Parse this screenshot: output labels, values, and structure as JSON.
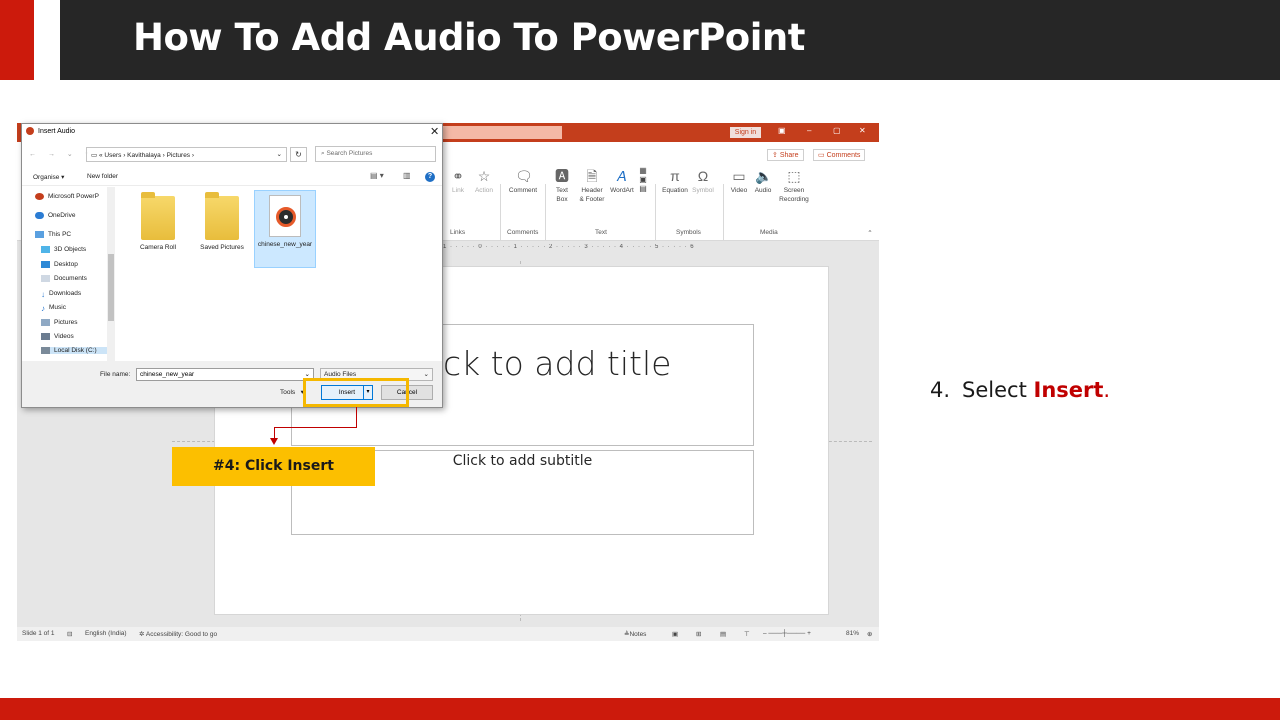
{
  "slide": {
    "title": "How To Add Audio To PowerPoint",
    "step_number": "4.",
    "step_prefix": "Select ",
    "step_keyword": "Insert",
    "step_suffix": ".",
    "callout": "#4: Click Insert",
    "colors": {
      "accent_red": "#cc1a0c",
      "title_bar": "#262626",
      "callout_yellow": "#fcbf00",
      "keyword_red": "#c00000"
    }
  },
  "powerpoint": {
    "sign_in": "Sign in",
    "share": "Share",
    "comments_btn": "Comments",
    "ribbon": {
      "link": "Link",
      "action": "Action",
      "comment": "Comment",
      "text_box": "Text\nBox",
      "header_footer": "Header\n& Footer",
      "wordart": "WordArt",
      "equation": "Equation",
      "symbol": "Symbol",
      "video": "Video",
      "audio": "Audio",
      "screen_recording": "Screen\nRecording",
      "groups": {
        "links": "Links",
        "comments": "Comments",
        "text": "Text",
        "symbols": "Symbols",
        "media": "Media"
      }
    },
    "ruler_h": "1 · · · · · 0 · · · · · 1 · · · · · 2 · · · · · 3 · · · · · 4 · · · · · 5 · · · · · 6",
    "placeholder_title": "Click to add title",
    "placeholder_subtitle": "Click to add subtitle",
    "status": {
      "slide": "Slide 1 of 1",
      "language": "English (India)",
      "accessibility": "Accessibility: Good to go",
      "notes": "Notes",
      "zoom": "81%"
    }
  },
  "dialog": {
    "title": "Insert Audio",
    "address": [
      "«",
      "Users",
      "›",
      "Kavithalaya",
      "›",
      "Pictures",
      "›"
    ],
    "search_placeholder": "Search Pictures",
    "organise": "Organise ▾",
    "new_folder": "New folder",
    "nav_items": [
      {
        "label": "Microsoft PowerP",
        "icon": "powerpoint-icon"
      },
      {
        "label": "OneDrive",
        "icon": "onedrive-icon"
      },
      {
        "label": "This PC",
        "icon": "pc-icon"
      },
      {
        "label": "3D Objects",
        "icon": "cube-icon"
      },
      {
        "label": "Desktop",
        "icon": "desktop-icon"
      },
      {
        "label": "Documents",
        "icon": "document-icon"
      },
      {
        "label": "Downloads",
        "icon": "download-icon"
      },
      {
        "label": "Music",
        "icon": "music-icon"
      },
      {
        "label": "Pictures",
        "icon": "pictures-icon"
      },
      {
        "label": "Videos",
        "icon": "video-icon"
      },
      {
        "label": "Local Disk (C:)",
        "icon": "disk-icon"
      }
    ],
    "files": [
      {
        "name": "Camera Roll",
        "kind": "folder"
      },
      {
        "name": "Saved Pictures",
        "kind": "folder"
      },
      {
        "name": "chinese_new_year",
        "kind": "audio"
      }
    ],
    "file_name_label": "File name:",
    "file_name_value": "chinese_new_year",
    "file_type": "Audio Files",
    "tools": "Tools",
    "insert": "Insert",
    "cancel": "Cancel"
  }
}
